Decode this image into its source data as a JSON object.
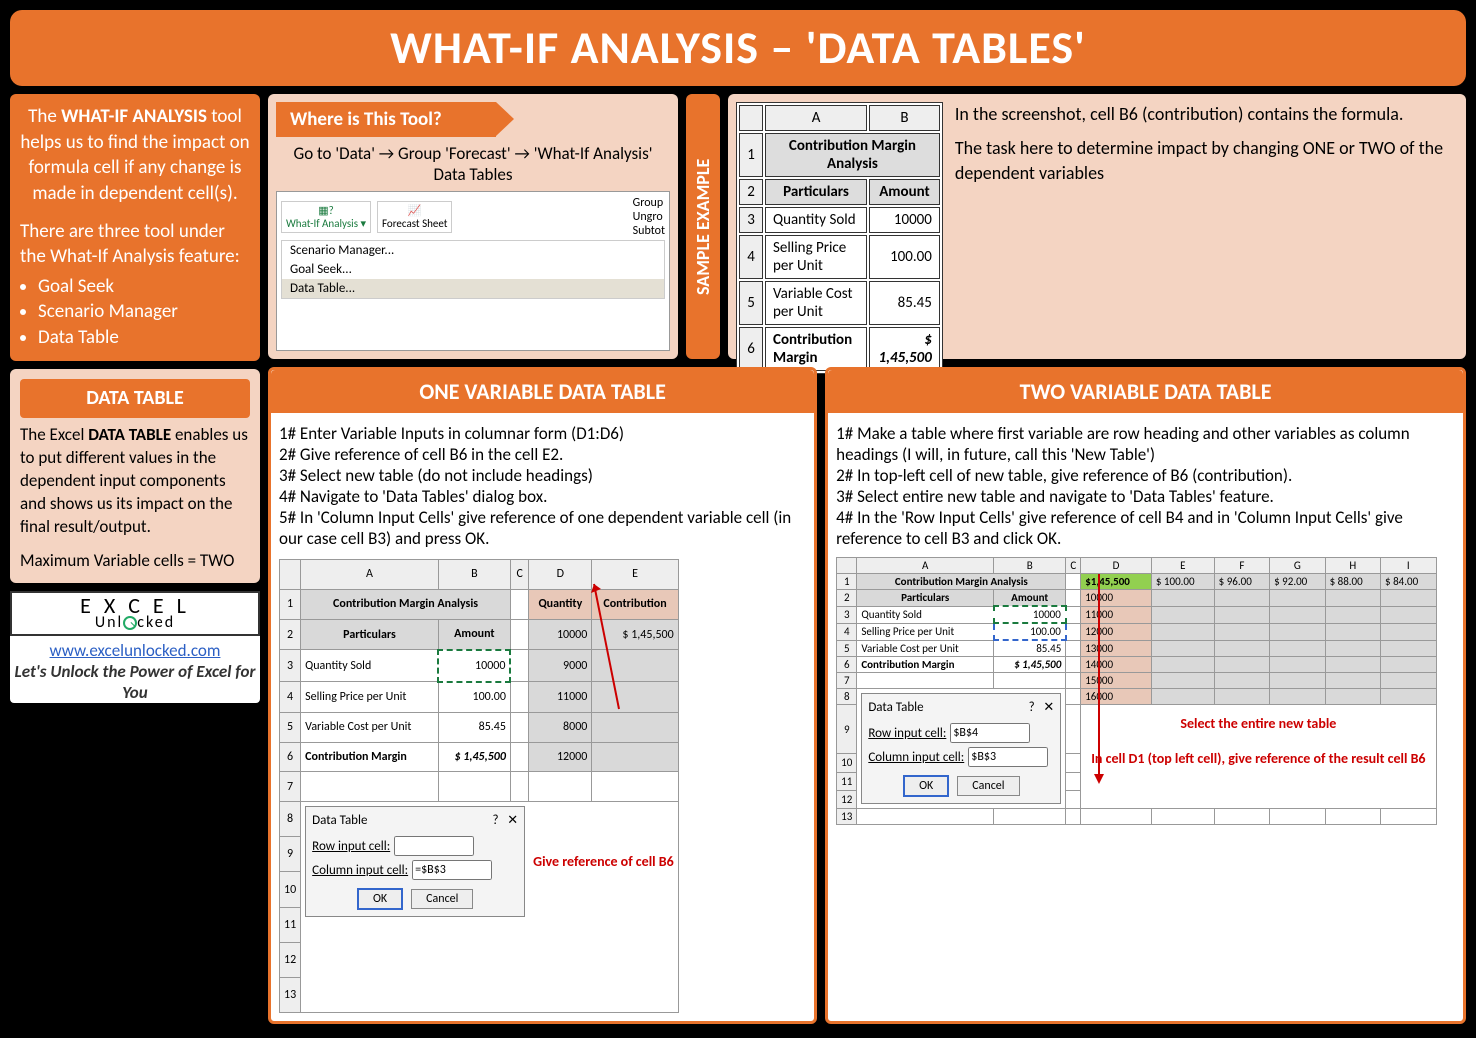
{
  "title": "WHAT-IF ANALYSIS – 'DATA TABLES'",
  "intro": {
    "text1a": "The ",
    "text1b": "WHAT-IF ANALYSIS",
    "text1c": " tool helps us to find the impact on formula cell if any change is made in dependent cell(s).",
    "text2": "There are three tool under the What-If Analysis feature:",
    "bullets": [
      "Goal Seek",
      "Scenario Manager",
      "Data Table"
    ]
  },
  "datatable_card": {
    "title": "DATA TABLE",
    "text1a": "The Excel ",
    "text1b": "DATA TABLE",
    "text1c": " enables us to put different values in the dependent input components and shows us its impact on the final result/output.",
    "text2": "Maximum Variable cells = TWO"
  },
  "logo": {
    "line1": "E X C E L",
    "line2": "Unl   cked",
    "url": "www.excelunlocked.com",
    "tagline": "Let's Unlock the Power of Excel for You"
  },
  "where": {
    "tab": "Where is This Tool?",
    "path": "Go to 'Data' → Group 'Forecast' → 'What-If Analysis' Data Tables",
    "btns": [
      "What-If Analysis ▾",
      "Forecast Sheet",
      "Group",
      "Ungro",
      "Subtot"
    ],
    "menu": [
      "Scenario Manager...",
      "Goal Seek...",
      "Data Table..."
    ]
  },
  "sample": {
    "vlabel": "SAMPLE EXAMPLE",
    "table": {
      "title": "Contribution Margin Analysis",
      "h1": "Particulars",
      "h2": "Amount",
      "r3": [
        "Quantity Sold",
        "10000"
      ],
      "r4": [
        "Selling Price per Unit",
        "100.00"
      ],
      "r5": [
        "Variable Cost per Unit",
        "85.45"
      ],
      "r6": [
        "Contribution Margin",
        "$  1,45,500"
      ]
    },
    "text1": "In the screenshot, cell B6 (contribution) contains the formula.",
    "text2": "The task here to determine impact by changing ONE or TWO of the dependent variables"
  },
  "one_var": {
    "title": "ONE VARIABLE DATA TABLE",
    "steps": {
      "s1": "1# Enter Variable Inputs in columnar form (D1:D6)",
      "s2": "2# Give reference of cell B6 in the cell E2.",
      "s3": "3# Select new table (do not include headings)",
      "s4": "4# Navigate to 'Data Tables' dialog box.",
      "s5": "5# In 'Column Input Cells' give reference of one dependent variable cell (in our case cell B3) and press OK."
    },
    "hdr_d": "Quantity",
    "hdr_e": "Contribution",
    "qtys": [
      "10000",
      "9000",
      "11000",
      "8000",
      "12000"
    ],
    "contrib": "$   1,45,500",
    "dialog_title": "Data Table",
    "row_label": "Row input cell:",
    "col_label": "Column input cell:",
    "col_val": "=$B$3",
    "ok": "OK",
    "cancel": "Cancel",
    "callout": "Give reference of cell B6"
  },
  "two_var": {
    "title": "TWO VARIABLE DATA TABLE",
    "steps": {
      "s1": "1# Make a table where first variable are row heading and other variables as column headings (I will, in future, call this 'New Table')",
      "s2": "2# In top-left cell of new table, give reference of B6 (contribution).",
      "s3": "3# Select entire new table and navigate to 'Data Tables' feature.",
      "s4": "4# In the 'Row Input Cells' give reference of cell B4 and in 'Column Input Cells' give reference to cell B3 and click OK."
    },
    "top_left": "$1,45,500",
    "prices": [
      "$  100.00",
      "$    96.00",
      "$    92.00",
      "$    88.00",
      "$    84.00"
    ],
    "qtys": [
      "10000",
      "11000",
      "12000",
      "13000",
      "14000",
      "15000",
      "16000"
    ],
    "row_val": "$B$4",
    "col_val": "$B$3",
    "callout1": "Select the entire new table",
    "callout2": "In cell D1 (top left cell), give reference of the result cell B6"
  }
}
